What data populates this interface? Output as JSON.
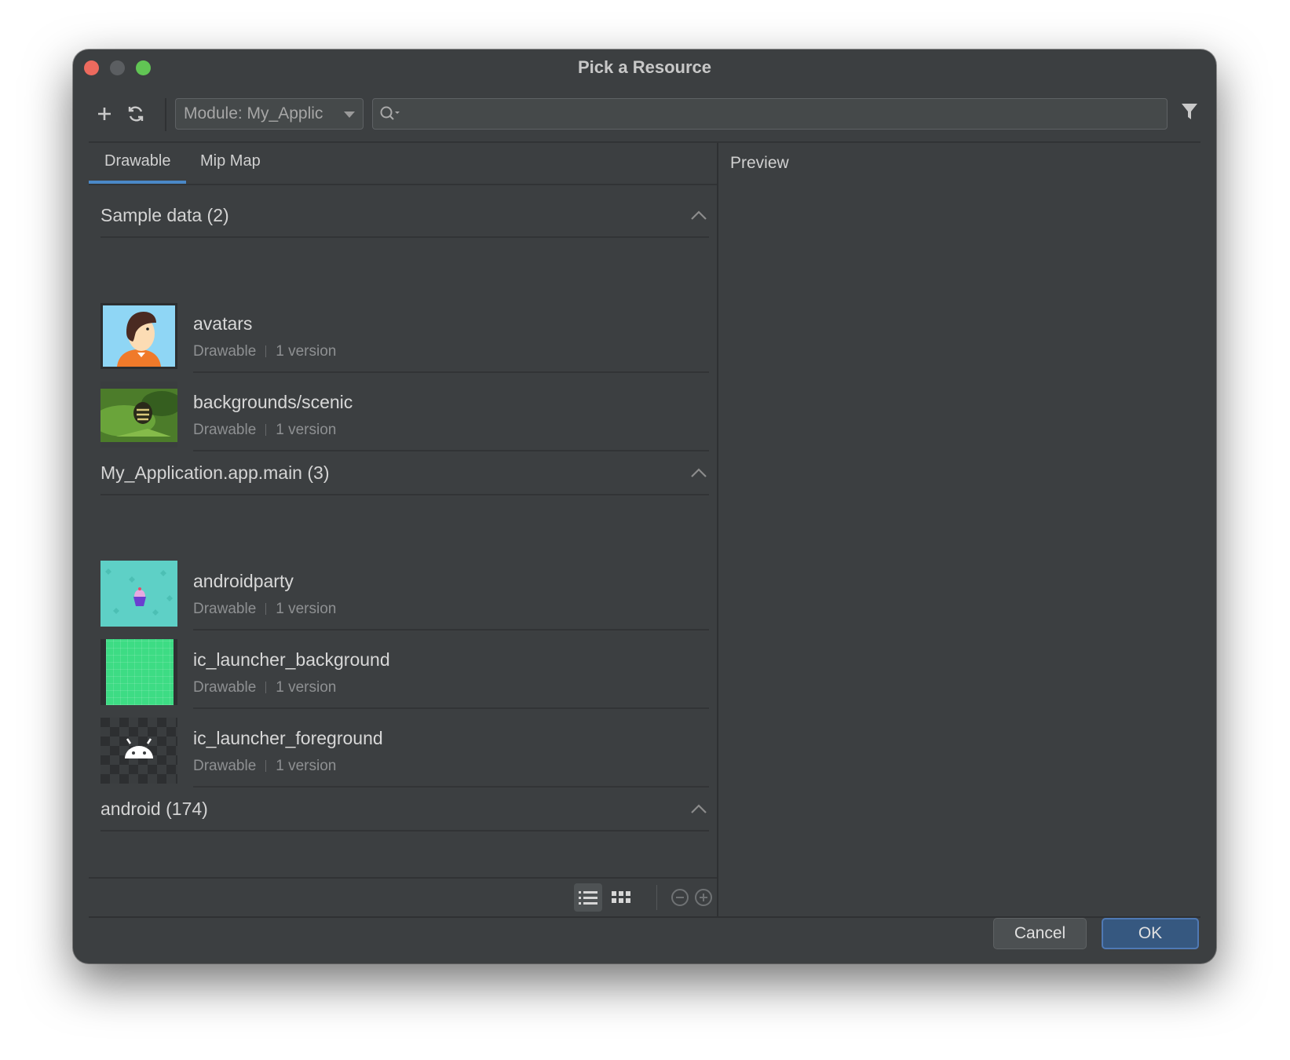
{
  "window": {
    "title": "Pick a Resource"
  },
  "toolbar": {
    "module_label": "Module: My_Applic",
    "search_value": "",
    "search_placeholder": ""
  },
  "tabs": [
    {
      "label": "Drawable",
      "active": true
    },
    {
      "label": "Mip Map",
      "active": false
    }
  ],
  "sections": [
    {
      "name": "Sample data (2)",
      "items": [
        {
          "name": "avatars",
          "type": "Drawable",
          "versions": "1 version"
        },
        {
          "name": "backgrounds/scenic",
          "type": "Drawable",
          "versions": "1 version"
        }
      ]
    },
    {
      "name": "My_Application.app.main (3)",
      "items": [
        {
          "name": "androidparty",
          "type": "Drawable",
          "versions": "1 version"
        },
        {
          "name": "ic_launcher_background",
          "type": "Drawable",
          "versions": "1 version"
        },
        {
          "name": "ic_launcher_foreground",
          "type": "Drawable",
          "versions": "1 version"
        }
      ]
    },
    {
      "name": "android (174)",
      "items": []
    }
  ],
  "preview": {
    "label": "Preview"
  },
  "buttons": {
    "cancel": "Cancel",
    "ok": "OK"
  },
  "colors": {
    "background": "#3c3f41",
    "accent": "#4a88c7",
    "ok_button": "#365880",
    "close": "#ed6a5e",
    "maximize": "#61c554"
  },
  "icons": [
    "add-icon",
    "refresh-icon",
    "search-icon",
    "filter-icon",
    "chevron-up-icon",
    "list-view-icon",
    "grid-view-icon",
    "zoom-out-icon",
    "zoom-in-icon"
  ]
}
